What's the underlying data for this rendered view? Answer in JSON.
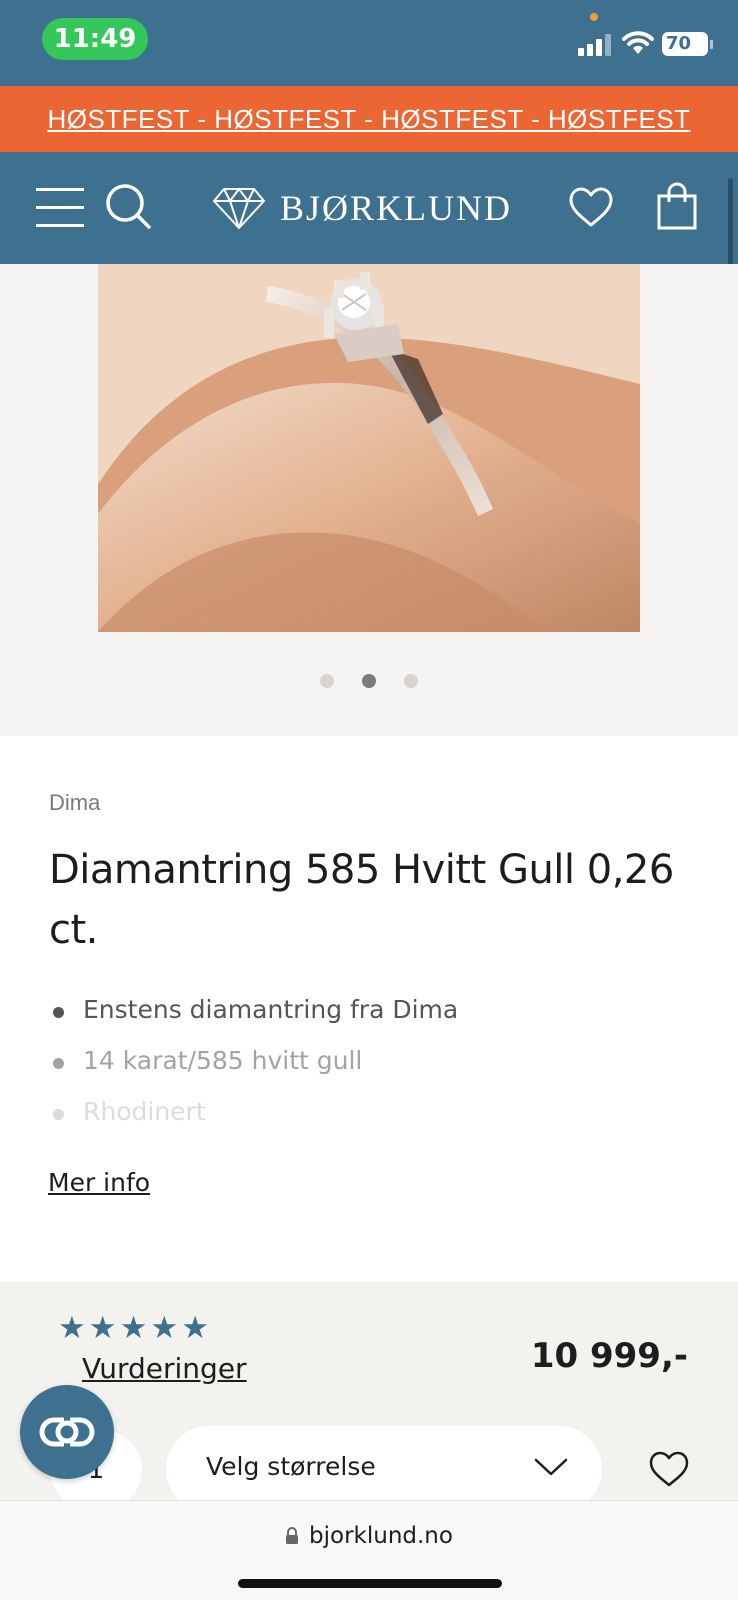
{
  "status_bar": {
    "time": "11:49",
    "battery": "70"
  },
  "promo": {
    "text": "HØSTFEST - HØSTFEST - HØSTFEST - HØSTFEST"
  },
  "header": {
    "logo_text": "BJØRKLUND"
  },
  "gallery": {
    "dot_count": 3,
    "active_dot": 2
  },
  "product": {
    "brand": "Dima",
    "title": "Diamantring 585 Hvitt Gull 0,26 ct.",
    "features": [
      "Enstens diamantring fra Dima",
      "14 karat/585 hvitt gull",
      "Rhodinert"
    ],
    "more_info": "Mer info",
    "rating_stars": 5,
    "reviews_label": "Vurderinger",
    "price": "10 999,-",
    "quantity": "1",
    "size_placeholder": "Velg størrelse"
  },
  "browser": {
    "url": "bjorklund.no"
  },
  "colors": {
    "brand_blue": "#3e7090",
    "promo_orange": "#ec6634",
    "status_green": "#34c759"
  }
}
